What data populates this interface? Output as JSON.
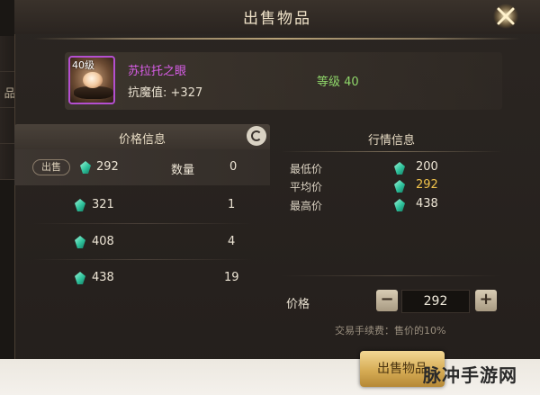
{
  "side_tabs": [
    "",
    "品",
    "",
    ""
  ],
  "dialog": {
    "title": "出售物品"
  },
  "item": {
    "level_badge": "40级",
    "name": "苏拉托之眼",
    "stat_label": "抗魔值:",
    "stat_value": "+327",
    "level_text": "等级 40",
    "rarity_color": "#b44fd0"
  },
  "price_panel": {
    "header": "价格信息",
    "sell_tag": "出售",
    "qty_label": "数量",
    "rows": [
      {
        "price": "292",
        "qty": "0"
      },
      {
        "price": "321",
        "qty": "1"
      },
      {
        "price": "408",
        "qty": "4"
      },
      {
        "price": "438",
        "qty": "19"
      }
    ]
  },
  "market_panel": {
    "header": "行情信息",
    "min_label": "最低价",
    "min_value": "200",
    "avg_label": "平均价",
    "avg_value": "292",
    "max_label": "最高价",
    "max_value": "438"
  },
  "sell_form": {
    "price_label": "价格",
    "minus": "−",
    "plus": "+",
    "price_value": "292",
    "fee_note": "交易手续费：售价的10%",
    "sell_button": "出售物品"
  },
  "watermark": "脉冲手游网",
  "colors": {
    "gem": "#2fc39c",
    "avg_highlight": "#f0c24b",
    "level_green": "#8fd66a",
    "item_name": "#d95ee8"
  },
  "icons": [
    "close-icon",
    "refresh-icon",
    "gem-icon",
    "minus-icon",
    "plus-icon"
  ]
}
